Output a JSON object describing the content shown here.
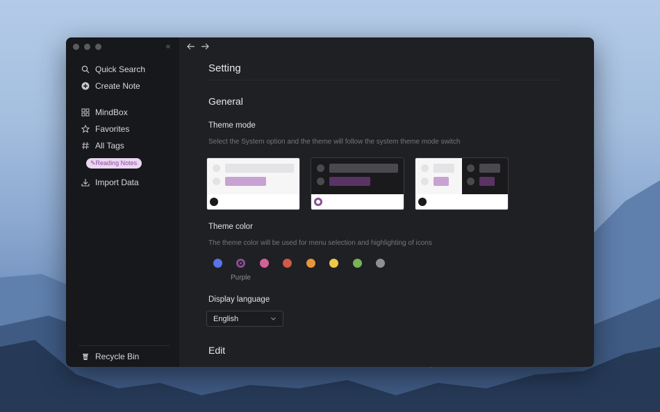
{
  "sidebar": {
    "items": [
      {
        "label": "Quick Search",
        "icon": "search-icon"
      },
      {
        "label": "Create Note",
        "icon": "plus-circle-icon"
      },
      {
        "label": "MindBox",
        "icon": "grid-icon"
      },
      {
        "label": "Favorites",
        "icon": "star-icon"
      },
      {
        "label": "All Tags",
        "icon": "hash-icon"
      },
      {
        "label": "Import Data",
        "icon": "download-icon"
      }
    ],
    "tag": {
      "label": "Reading Notes",
      "icon": "pencil-icon"
    },
    "recycle_bin": "Recycle Bin"
  },
  "main": {
    "title": "Setting",
    "general": "General",
    "theme_mode": {
      "label": "Theme mode",
      "description": "Select the System option and the theme will follow the system theme mode switch",
      "options": [
        "light",
        "dark",
        "system"
      ],
      "selected": "dark"
    },
    "theme_color": {
      "label": "Theme color",
      "description": "The theme color will be used for menu selection and highlighting of icons",
      "colors": [
        "#5b72e8",
        "#8a4e96",
        "#d4609a",
        "#cf5a45",
        "#e8943c",
        "#ecc94b",
        "#7bb35a",
        "#8f9093"
      ],
      "selected_index": 1,
      "selected_name": "Purple"
    },
    "display_language": {
      "label": "Display language",
      "value": "English"
    },
    "edit": "Edit"
  }
}
